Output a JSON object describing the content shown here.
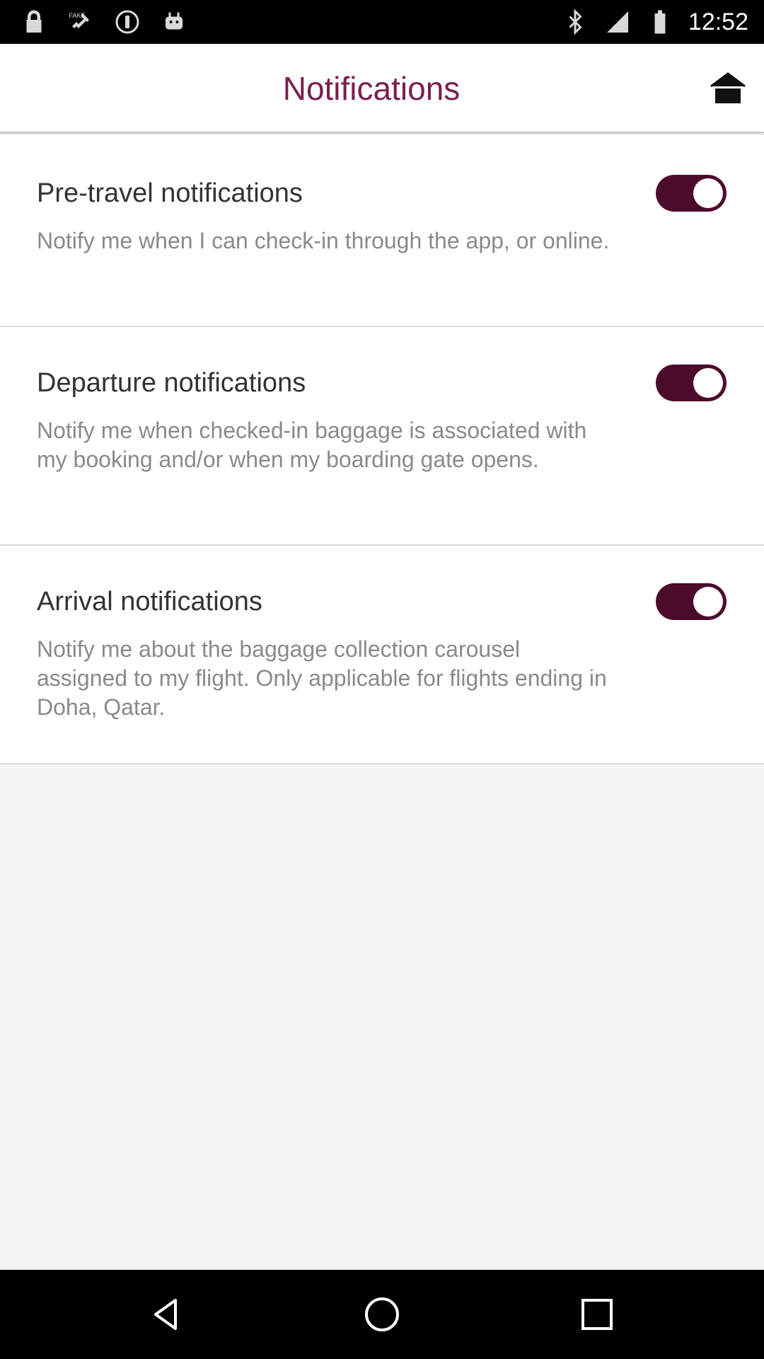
{
  "status_bar": {
    "time": "12:52",
    "icons_left": [
      "lock-icon",
      "fake-gps-icon",
      "info-icon",
      "android-icon"
    ],
    "icons_right": [
      "bluetooth-icon",
      "signal-icon",
      "battery-icon"
    ]
  },
  "header": {
    "title": "Notifications",
    "home_icon": "home-icon"
  },
  "settings": [
    {
      "title": "Pre-travel notifications",
      "description": "Notify me when I can check-in through the app, or online.",
      "enabled": true
    },
    {
      "title": "Departure notifications",
      "description": "Notify me when checked-in baggage is associated with my booking and/or when my boarding gate opens.",
      "enabled": true
    },
    {
      "title": "Arrival notifications",
      "description": "Notify me about the baggage collection carousel assigned to my flight. Only applicable for flights ending in Doha, Qatar.",
      "enabled": true
    }
  ],
  "nav_bar": {
    "icons": [
      "back-icon",
      "home-circle-icon",
      "recents-icon"
    ]
  },
  "colors": {
    "accent": "#7a1f4e",
    "toggle_on": "#4d0b2c",
    "background": "#f4f4f4"
  }
}
